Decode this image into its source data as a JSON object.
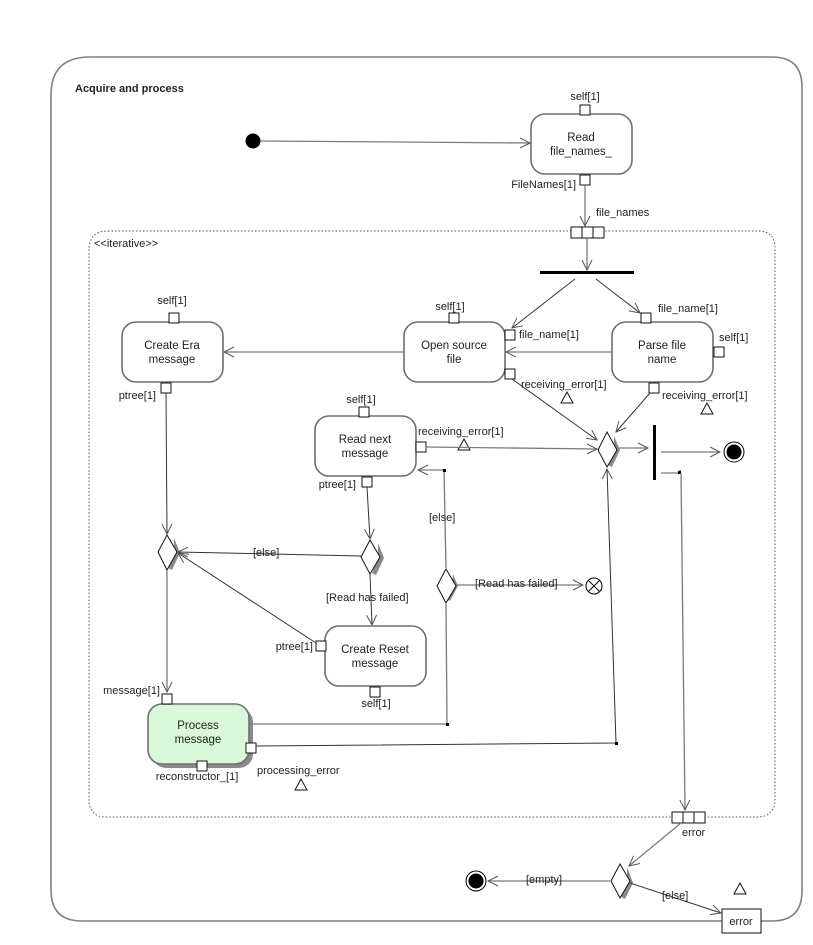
{
  "diagram": {
    "title": "Acquire and process",
    "region_stereotype": "<<iterative>>",
    "actions": {
      "read_file_names": {
        "line1": "Read",
        "line2": "file_names_",
        "pin_top": "self[1]",
        "pin_bottom": "FileNames[1]"
      },
      "create_era": {
        "line1": "Create Era",
        "line2": "message",
        "pin_top": "self[1]",
        "pin_bottom": "ptree[1]"
      },
      "open_source": {
        "line1": "Open source",
        "line2": "file",
        "pin_top": "self[1]",
        "pin_right_in": "file_name[1]",
        "pin_right_err": "receiving_error[1]"
      },
      "parse_file": {
        "line1": "Parse file",
        "line2": "name",
        "pin_top": "file_name[1]",
        "pin_right": "self[1]",
        "pin_bottom": "receiving_error[1]"
      },
      "read_next": {
        "line1": "Read next",
        "line2": "message",
        "pin_top": "self[1]",
        "pin_bottom": "ptree[1]",
        "pin_right": "receiving_error[1]"
      },
      "create_reset": {
        "line1": "Create Reset",
        "line2": "message",
        "pin_left": "ptree[1]",
        "pin_bottom": "self[1]"
      },
      "process_message": {
        "line1": "Process",
        "line2": "message",
        "pin_top": "message[1]",
        "pin_bottom": "reconstructor_[1]",
        "pin_right": "processing_error"
      }
    },
    "expansion_nodes": {
      "input": "file_names",
      "output": "error"
    },
    "guards": {
      "else_left": "[else]",
      "read_failed_down": "[Read has failed]",
      "else_vertical": "[else]",
      "read_failed_right": "[Read has failed]",
      "empty": "[empty]",
      "else_bottom": "[else]"
    },
    "output_parameter": "error",
    "colors": {
      "highlight_fill": "#d9f7d9",
      "frame_stroke": "#808080"
    }
  }
}
